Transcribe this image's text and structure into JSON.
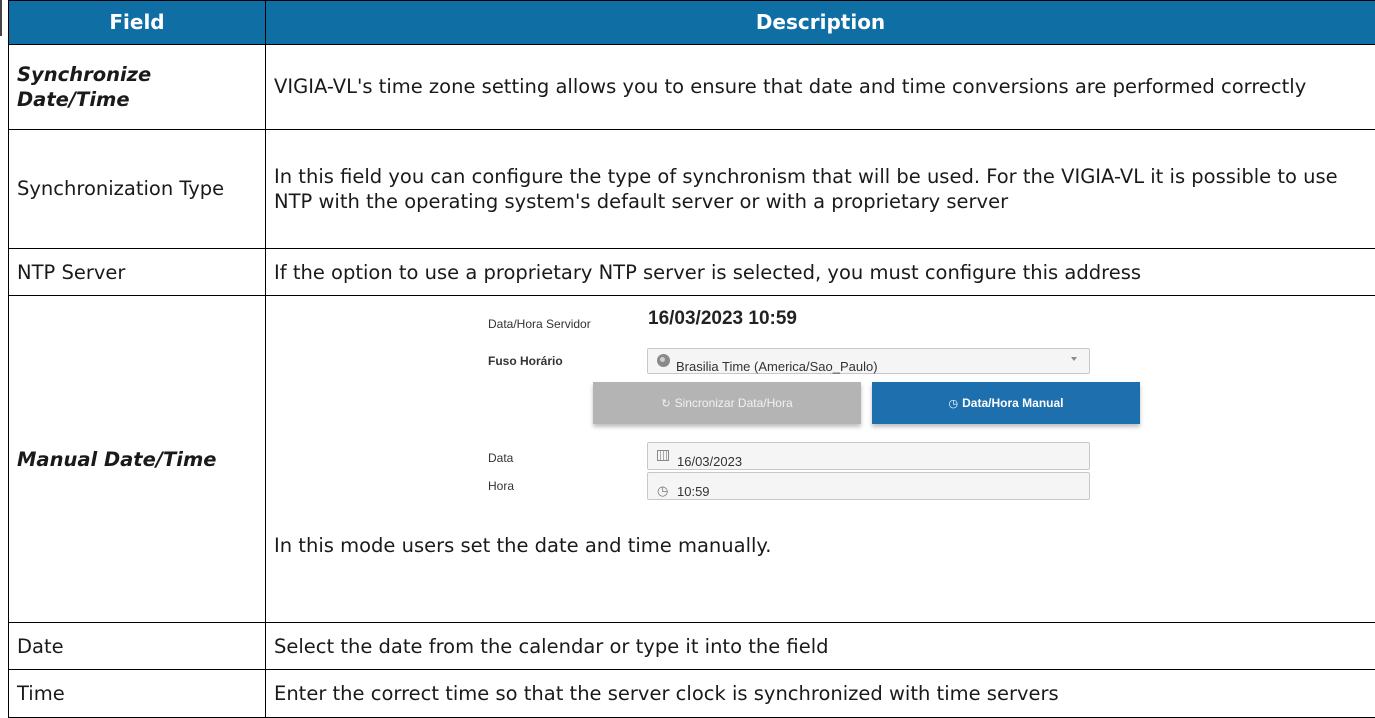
{
  "headers": {
    "field": "Field",
    "description": "Description"
  },
  "rows": [
    {
      "field": "Synchronize Date/Time",
      "description": "VIGIA-VL's time zone setting allows you to ensure that date and time conversions are performed correctly"
    },
    {
      "field": "Synchronization Type",
      "description": "In this field you can configure the type of synchronism that will be used. For the VIGIA-VL it is possible to use NTP with the operating system's default server or with a proprietary server"
    },
    {
      "field": "NTP Server",
      "description": "If the option to use a proprietary NTP server is selected, you must configure this address"
    },
    {
      "field": "Manual Date/Time",
      "description": "In this mode users set the date and time manually."
    },
    {
      "field": "Date",
      "description": "Select the date from the calendar or type it into the field"
    },
    {
      "field": "Time",
      "description": "Enter the correct time so that the server clock is synchronized with time servers"
    }
  ],
  "screenshot": {
    "server_label": "Data/Hora Servidor",
    "server_value": "16/03/2023 10:59",
    "timezone_label": "Fuso Horário",
    "timezone_value": "Brasilia Time (America/Sao_Paulo)",
    "sync_button": "Sincronizar Data/Hora",
    "manual_button": "Data/Hora Manual",
    "date_label": "Data",
    "date_value": "16/03/2023",
    "time_label": "Hora",
    "time_value": "10:59"
  },
  "colors": {
    "header_bg": "#0f6fa5",
    "manual_button": "#1d70ad",
    "sync_button": "#b4b4b4"
  }
}
